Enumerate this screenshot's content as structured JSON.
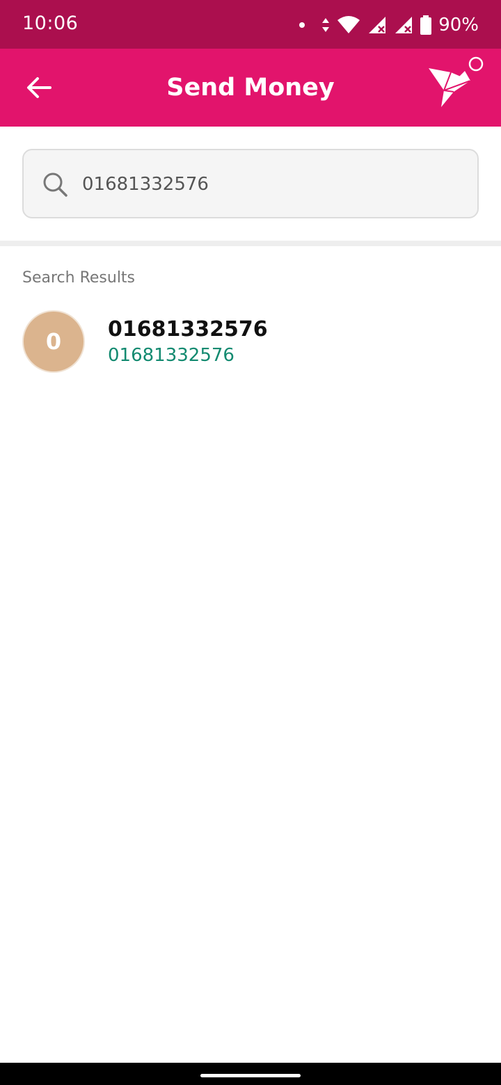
{
  "status_bar": {
    "time": "10:06",
    "battery_text": "90%",
    "icons": [
      "notification-dot-icon",
      "data-arrows-icon",
      "wifi-icon",
      "cell-signal-icon",
      "cell-signal-icon",
      "battery-icon"
    ]
  },
  "app_bar": {
    "title": "Send Money",
    "back_icon": "arrow-left-icon",
    "logo_icon": "bird-logo-icon"
  },
  "search": {
    "value": "01681332576",
    "icon": "search-icon"
  },
  "results": {
    "label": "Search Results",
    "items": [
      {
        "avatar_initial": "0",
        "name": "01681332576",
        "number": "01681332576"
      }
    ]
  },
  "colors": {
    "status_bar": "#ab0f4e",
    "app_bar": "#e2146c",
    "accent_number": "#138a70",
    "avatar": "#dbb48e"
  }
}
